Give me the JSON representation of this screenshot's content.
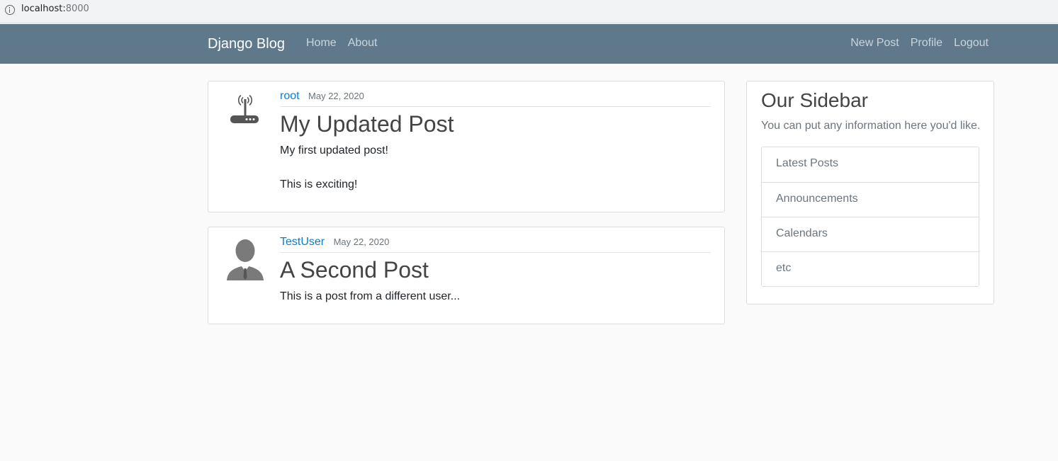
{
  "browser": {
    "url_host": "localhost:",
    "url_port": "8000"
  },
  "navbar": {
    "brand": "Django Blog",
    "left_links": [
      "Home",
      "About"
    ],
    "right_links": [
      "New Post",
      "Profile",
      "Logout"
    ]
  },
  "posts": [
    {
      "author": "root",
      "date": "May 22, 2020",
      "title": "My Updated Post",
      "content": "My first updated post!\n\nThis is exciting!",
      "avatar": "router-icon"
    },
    {
      "author": "TestUser",
      "date": "May 22, 2020",
      "title": "A Second Post",
      "content": "This is a post from a different user...",
      "avatar": "user-silhouette-icon"
    }
  ],
  "sidebar": {
    "title": "Our Sidebar",
    "text": "You can put any information here you'd like.",
    "items": [
      "Latest Posts",
      "Announcements",
      "Calendars",
      "etc"
    ]
  },
  "colors": {
    "navbar_bg": "#5f788a",
    "link_blue": "#0b7dd0",
    "page_bg": "#fafafa"
  }
}
